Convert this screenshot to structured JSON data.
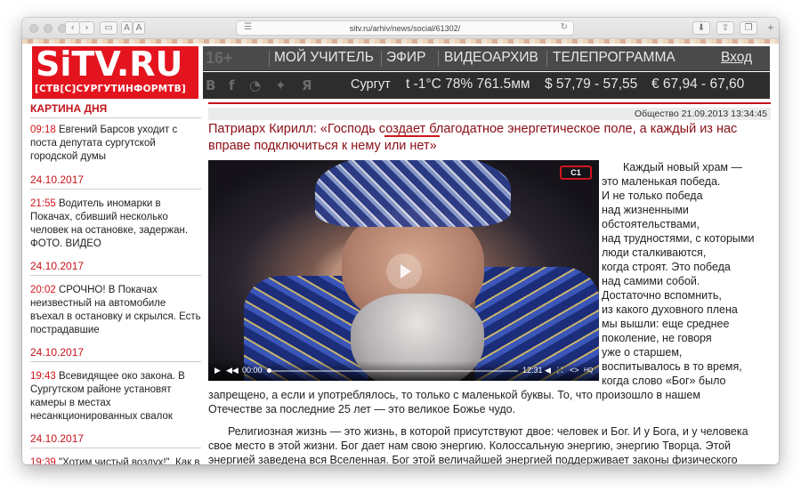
{
  "browser": {
    "url": "sitv.ru/arhiv/news/social/61302/"
  },
  "logo": {
    "main": "SiTV.RU",
    "sub": "[СТВ[С]СУРГУТИНФОРМТВ]"
  },
  "nav": {
    "age": "16+",
    "items": [
      "МОЙ УЧИТЕЛЬ",
      "ЭФИР",
      "ВИДЕОАРХИВ",
      "ТЕЛЕПРОГРАММА"
    ],
    "login": "Вход"
  },
  "info": {
    "social_icons": [
      "vk-icon",
      "facebook-icon",
      "rss-icon",
      "twitter-icon",
      "yandex-icon"
    ],
    "city": "Сургут",
    "weather": "t -1°C 78% 761.5мм",
    "usd": "$ 57,79 - 57,55",
    "eur": "€ 67,94 - 67,60"
  },
  "sidebar": {
    "title": "КАРТИНА ДНЯ",
    "news": [
      {
        "time": "09:18",
        "text": "Евгений Барсов уходит с поста депутата сургутской городской думы"
      },
      {
        "date": "24.10.2017"
      },
      {
        "time": "21:55",
        "text": "Водитель иномарки в Покачах, сбивший несколько человек на остановке, задержан. ФОТО. ВИДЕО"
      },
      {
        "date": "24.10.2017"
      },
      {
        "time": "20:02",
        "text": "СРОЧНО! В Покачах неизвестный на автомобиле въехал в остановку и скрылся. Есть пострадавшие"
      },
      {
        "date": "24.10.2017"
      },
      {
        "time": "19:43",
        "text": "Всевидящее око закона. В Сургутском районе установят камеры в местах несанкционированных свалок"
      },
      {
        "date": "24.10.2017"
      },
      {
        "time": "19:39",
        "text": "\"Хотим чистый воздух!\". Как в"
      }
    ]
  },
  "article": {
    "meta": "Общество 21.09.2013 13:34:45",
    "title": "Патриарх Кирилл: «Господь создает благодатное энергетическое поле, а каждый из нас вправе подключиться к нему или нет»",
    "video": {
      "channel_logo": "С1",
      "time_current": "00:00",
      "time_total": "12:31",
      "quality": "HQ"
    },
    "side_lines": [
      "Каждый новый храм —",
      "это маленькая победа.",
      "И не только победа",
      "над жизненными",
      "обстоятельствами,",
      "над трудностями, с которыми",
      "люди сталкиваются,",
      "когда строят. Это победа",
      "над самими собой.",
      "Достаточно вспомнить,",
      "из какого духовного плена",
      "мы вышли: еще среднее",
      "поколение, не говоря",
      "уже о старшем,",
      "воспитывалось в то время,",
      "когда слово «Бог» было"
    ],
    "para1_line1": "запрещено, а если и употреблялось, то только с маленькой буквы. То, что произошло в нашем",
    "para1_line2": "Отечестве за последние 25 лет — это великое Божье чудо.",
    "para2_lines": [
      "Религиозная жизнь — это жизнь, в которой присутствуют двое: человек и Бог. И у Бога, и у человека",
      "свое место в этой жизни. Бог дает нам свою энергию. Колоссальную энергию, энергию Творца. Этой",
      "энергией заведена вся Вселенная. Бог этой величайшей энергией поддерживает законы физического"
    ]
  }
}
